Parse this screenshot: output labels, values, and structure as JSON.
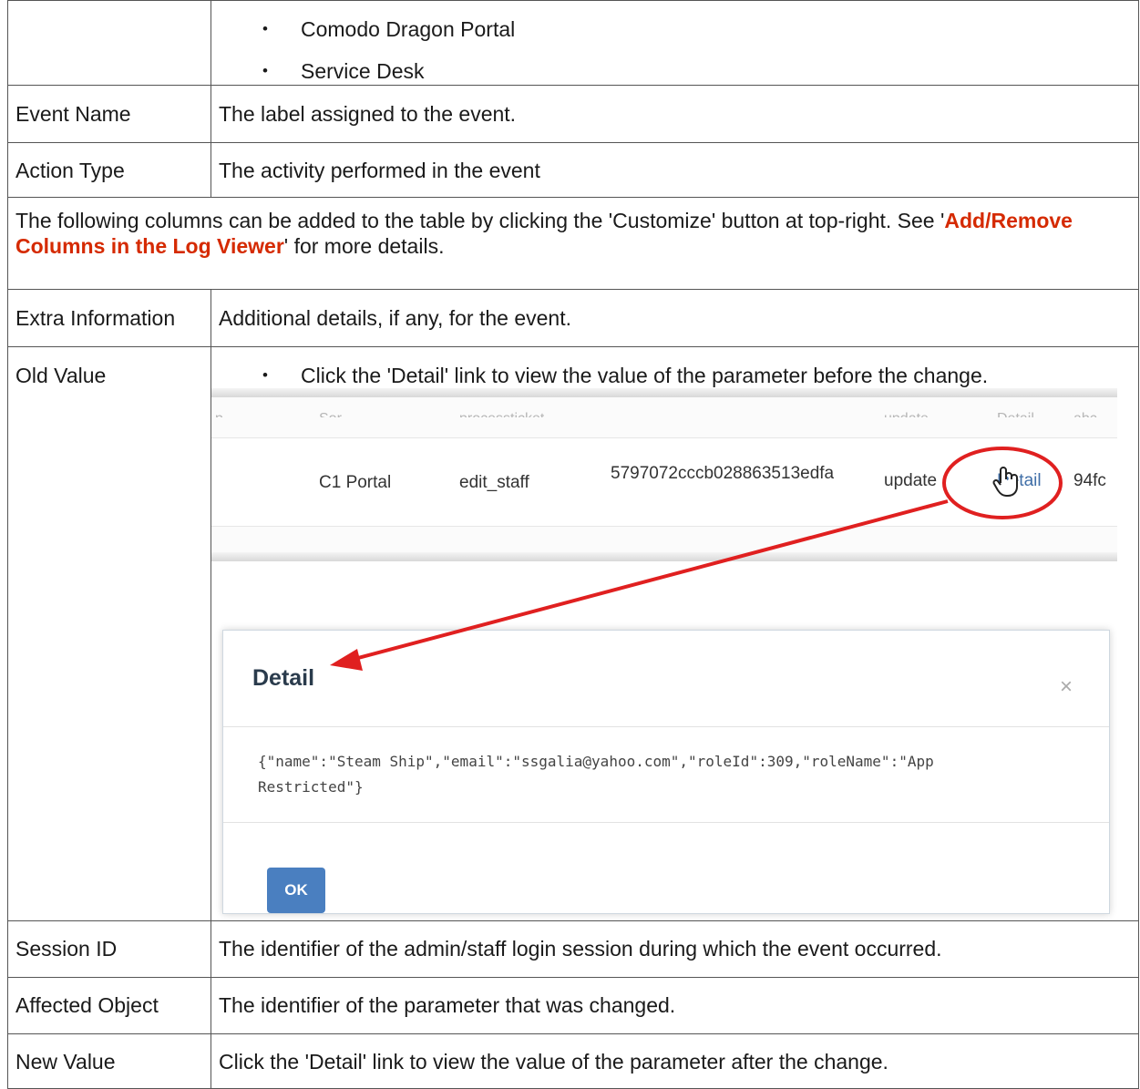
{
  "top_row": {
    "bullets": [
      "Comodo Dragon Portal",
      "Service Desk"
    ]
  },
  "rows": {
    "event_name": {
      "label": "Event Name",
      "desc": "The label assigned to the event."
    },
    "action_type": {
      "label": "Action Type",
      "desc": "The activity performed in the event"
    },
    "extra_info": {
      "label": "Extra Information",
      "desc": "Additional details, if any, for the event."
    },
    "old_value": {
      "label": "Old Value",
      "bullet": "Click the 'Detail' link to view the value of the parameter before the change."
    },
    "session_id": {
      "label": "Session ID",
      "desc": "The identifier of the admin/staff login session during which the event occurred."
    },
    "affected_object": {
      "label": "Affected Object",
      "desc": "The identifier of the parameter that was changed."
    },
    "new_value": {
      "label": "New Value",
      "desc": "Click the 'Detail' link to view the value of the parameter after the change."
    }
  },
  "note": {
    "before": "The following columns can be added to the table by clicking the 'Customize' button at top-right. See '",
    "link": "Add/Remove Columns in the Log Viewer",
    "after": "' for more details."
  },
  "screenshot": {
    "faded_row": [
      "p",
      "Sor",
      "processticket",
      "update",
      "Detail",
      "abc"
    ],
    "row": {
      "portal": "C1 Portal",
      "action": "edit_staff",
      "session": "5797072cccb028863513edfa",
      "type": "update",
      "detail": "Detail",
      "extra": "94fc"
    },
    "dialog": {
      "title": "Detail",
      "close": "×",
      "body_line1": "{\"name\":\"Steam Ship\",\"email\":\"ssgalia@yahoo.com\",\"roleId\":309,\"roleName\":\"App",
      "body_line2": "Restricted\"}",
      "ok": "OK"
    }
  },
  "colors": {
    "link": "#d52a00",
    "callout": "#e02020",
    "button": "#4a7fc0"
  }
}
